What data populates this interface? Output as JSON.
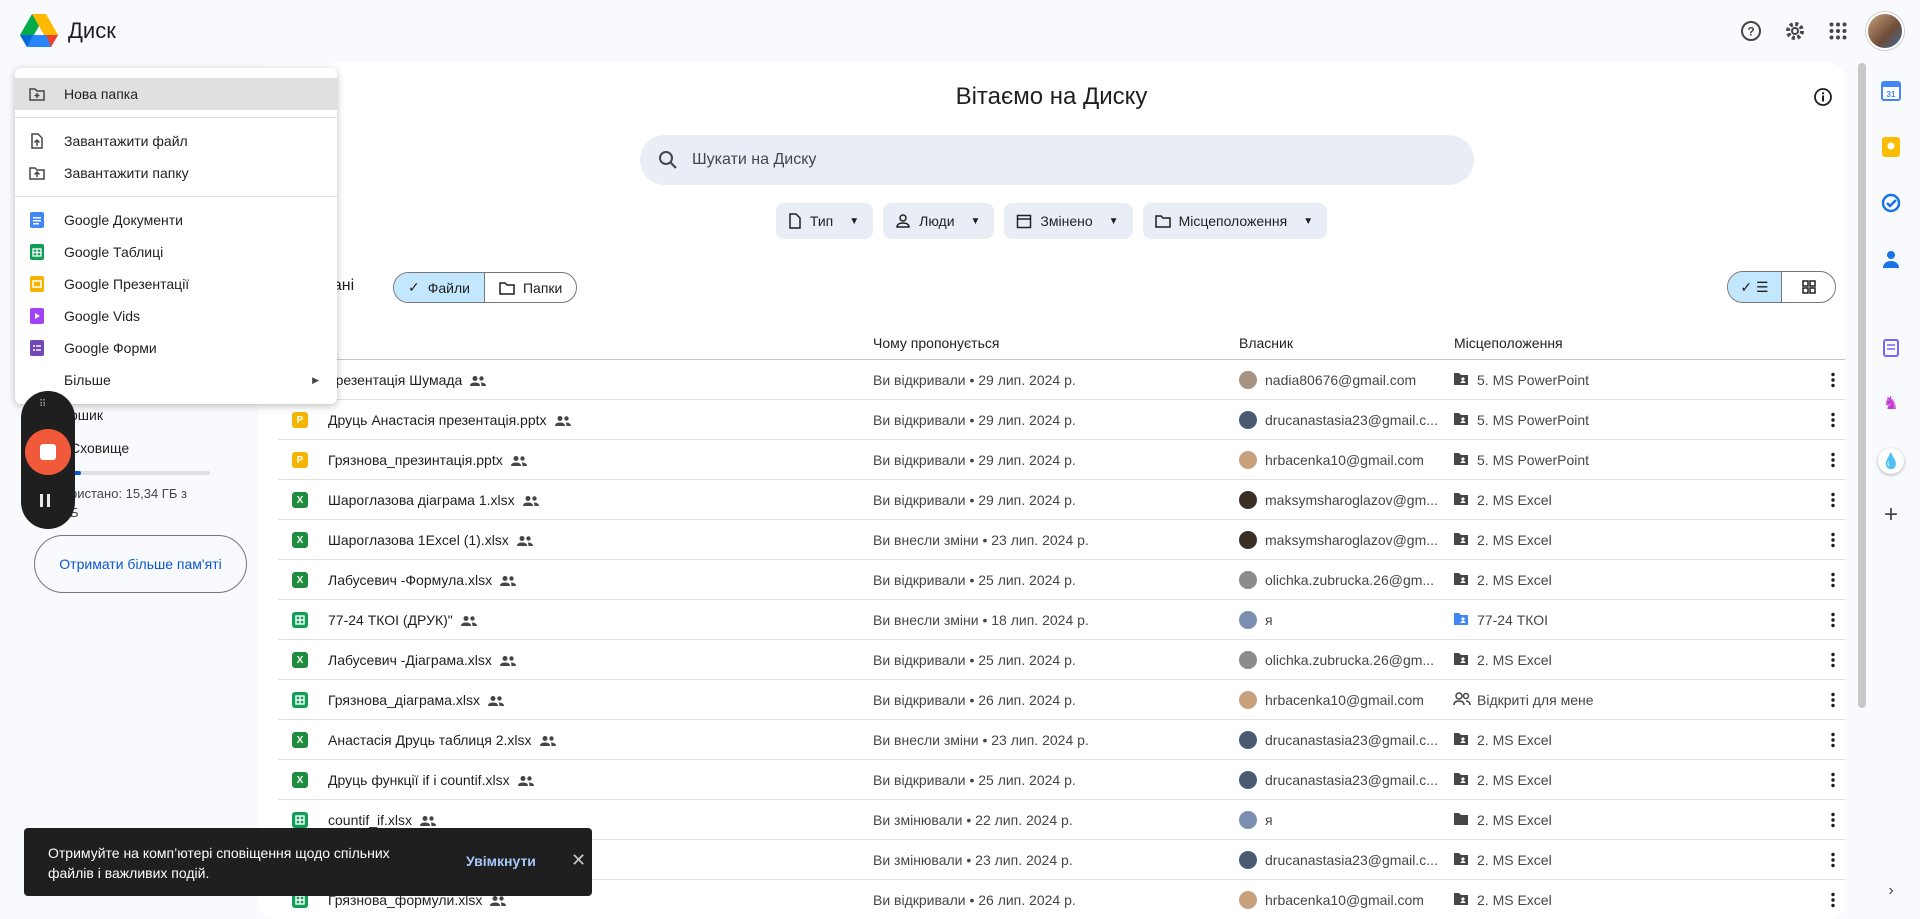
{
  "app": {
    "title": "Диск"
  },
  "main": {
    "welcome": "Вітаємо на Диску",
    "search_placeholder": "Шукати на Диску",
    "filters": [
      "Тип",
      "Люди",
      "Змінено",
      "Місцеположення"
    ],
    "section_title": "ovані",
    "segments": {
      "files": "Файли",
      "folders": "Папки"
    },
    "columns": {
      "reason": "Чому пропонується",
      "owner": "Власник",
      "location": "Місцеположення"
    }
  },
  "rows": [
    {
      "icon": "ppt",
      "name": "презентація Шумада",
      "reason": "Ви відкривали • 29 лип. 2024 р.",
      "owner": "nadia80676@gmail.com",
      "avatar": "#a89484",
      "loc_icon": "shared-folder",
      "location": "5. MS PowerPoint"
    },
    {
      "icon": "ppt",
      "name": "Друць Анастасія презентація.pptx",
      "reason": "Ви відкривали • 29 лип. 2024 р.",
      "owner": "drucanastasia23@gmail.c...",
      "avatar": "#4a5a70",
      "loc_icon": "shared-folder",
      "location": "5. MS PowerPoint"
    },
    {
      "icon": "ppt",
      "name": "Грязнова_презинтація.pptx",
      "reason": "Ви відкривали • 29 лип. 2024 р.",
      "owner": "hrbacenka10@gmail.com",
      "avatar": "#c8a27c",
      "loc_icon": "shared-folder",
      "location": "5. MS PowerPoint"
    },
    {
      "icon": "xls",
      "name": "Шароглазова діаграма 1.xlsx",
      "reason": "Ви відкривали • 29 лип. 2024 р.",
      "owner": "maksymsharoglazov@gm...",
      "avatar": "#3a3028",
      "loc_icon": "shared-folder",
      "location": "2. MS Excel"
    },
    {
      "icon": "xls",
      "name": "Шароглазова 1Excel (1).xlsx",
      "reason": "Ви внесли зміни • 23 лип. 2024 р.",
      "owner": "maksymsharoglazov@gm...",
      "avatar": "#3a3028",
      "loc_icon": "shared-folder",
      "location": "2. MS Excel"
    },
    {
      "icon": "xls",
      "name": "Лабусевич -Формула.xlsx",
      "reason": "Ви відкривали • 25 лип. 2024 р.",
      "owner": "olichka.zubrucka.26@gm...",
      "avatar": "#8a8a8a",
      "loc_icon": "shared-folder",
      "location": "2. MS Excel"
    },
    {
      "icon": "sheet",
      "name": "77-24 ТКОІ (ДРУК)\"",
      "reason": "Ви внесли зміни • 18 лип. 2024 р.",
      "owner": "я",
      "avatar": "#7a8fb0",
      "loc_icon": "blue-folder",
      "location": "77-24 ТКОІ"
    },
    {
      "icon": "xls",
      "name": "Лабусевич -Діаграма.xlsx",
      "reason": "Ви відкривали • 25 лип. 2024 р.",
      "owner": "olichka.zubrucka.26@gm...",
      "avatar": "#8a8a8a",
      "loc_icon": "shared-folder",
      "location": "2. MS Excel"
    },
    {
      "icon": "sheet",
      "name": "Грязнова_діаграма.xlsx",
      "reason": "Ви відкривали • 26 лип. 2024 р.",
      "owner": "hrbacenka10@gmail.com",
      "avatar": "#c8a27c",
      "loc_icon": "people",
      "location": "Відкриті для мене"
    },
    {
      "icon": "xls",
      "name": "Анастасія Друць таблиця 2.xlsx",
      "reason": "Ви внесли зміни • 23 лип. 2024 р.",
      "owner": "drucanastasia23@gmail.c...",
      "avatar": "#4a5a70",
      "loc_icon": "shared-folder",
      "location": "2. MS Excel"
    },
    {
      "icon": "xls",
      "name": "Друць функції if і countif.xlsx",
      "reason": "Ви відкривали • 25 лип. 2024 р.",
      "owner": "drucanastasia23@gmail.c...",
      "avatar": "#4a5a70",
      "loc_icon": "shared-folder",
      "location": "2. MS Excel"
    },
    {
      "icon": "sheet",
      "name": "countif_if.xlsx",
      "reason": "Ви змінювали • 22 лип. 2024 р.",
      "owner": "я",
      "avatar": "#7a8fb0",
      "loc_icon": "folder",
      "location": "2. MS Excel"
    },
    {
      "icon": "xls",
      "name": "",
      "reason": "Ви змінювали • 23 лип. 2024 р.",
      "owner": "drucanastasia23@gmail.c...",
      "avatar": "#4a5a70",
      "loc_icon": "shared-folder",
      "location": "2. MS Excel"
    },
    {
      "icon": "sheet",
      "name": "Грязнова_формули.xlsx",
      "reason": "Ви відкривали • 26 лип. 2024 р.",
      "owner": "hrbacenka10@gmail.com",
      "avatar": "#c8a27c",
      "loc_icon": "shared-folder",
      "location": "2. MS Excel"
    }
  ],
  "sidebar": {
    "trash_partial": "ошик",
    "storage_partial": "Сховище",
    "usage_line1": "ристано: 15,34 ГБ з",
    "usage_line2": "Б",
    "storage_used_fraction": 0.08,
    "get_more": "Отримати більше пам'яті"
  },
  "menu": {
    "new_folder": "Нова папка",
    "upload_file": "Завантажити файл",
    "upload_folder": "Завантажити папку",
    "docs": "Google Документи",
    "sheets": "Google Таблиці",
    "slides": "Google Презентації",
    "vids": "Google Vids",
    "forms": "Google Форми",
    "more": "Більше"
  },
  "toast": {
    "message": "Отримуйте на комп’ютері сповіщення щодо спільних файлів і важливих подій.",
    "action": "Увімкнути"
  },
  "colors": {
    "ppt": "#f4b400",
    "xls": "#1e8e3e",
    "sheet": "#0f9d58",
    "accent": "#0b57d0",
    "selected": "#c2e7ff"
  }
}
